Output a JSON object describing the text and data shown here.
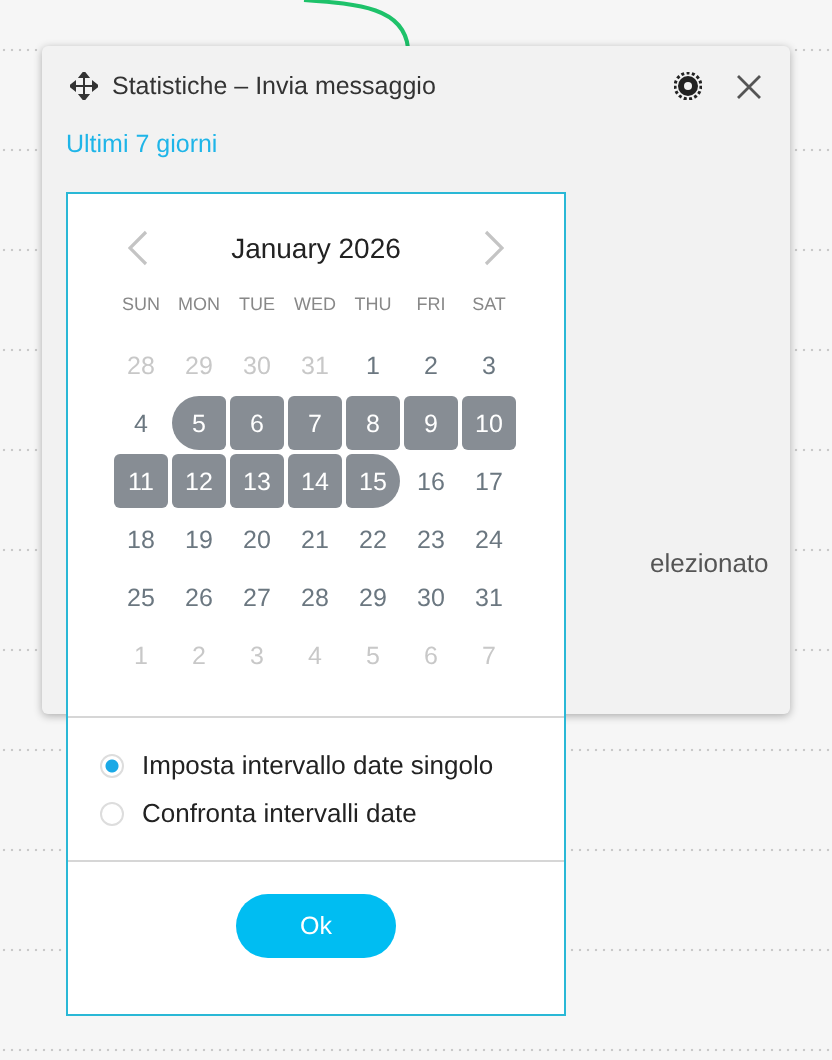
{
  "panel": {
    "title": "Statistiche – Invia messaggio",
    "range_link": "Ultimi 7 giorni",
    "background_text": "elezionato"
  },
  "calendar": {
    "month": "January 2026",
    "weekdays": [
      "SUN",
      "MON",
      "TUE",
      "WED",
      "THU",
      "FRI",
      "SAT"
    ],
    "weeks": [
      [
        {
          "label": "28",
          "outside": true,
          "selected": false
        },
        {
          "label": "29",
          "outside": true,
          "selected": false
        },
        {
          "label": "30",
          "outside": true,
          "selected": false
        },
        {
          "label": "31",
          "outside": true,
          "selected": false
        },
        {
          "label": "1",
          "outside": false,
          "selected": false
        },
        {
          "label": "2",
          "outside": false,
          "selected": false
        },
        {
          "label": "3",
          "outside": false,
          "selected": false
        }
      ],
      [
        {
          "label": "4",
          "outside": false,
          "selected": false
        },
        {
          "label": "5",
          "outside": false,
          "selected": true
        },
        {
          "label": "6",
          "outside": false,
          "selected": true
        },
        {
          "label": "7",
          "outside": false,
          "selected": true
        },
        {
          "label": "8",
          "outside": false,
          "selected": true
        },
        {
          "label": "9",
          "outside": false,
          "selected": true
        },
        {
          "label": "10",
          "outside": false,
          "selected": true
        }
      ],
      [
        {
          "label": "11",
          "outside": false,
          "selected": true
        },
        {
          "label": "12",
          "outside": false,
          "selected": true
        },
        {
          "label": "13",
          "outside": false,
          "selected": true
        },
        {
          "label": "14",
          "outside": false,
          "selected": true
        },
        {
          "label": "15",
          "outside": false,
          "selected": true
        },
        {
          "label": "16",
          "outside": false,
          "selected": false
        },
        {
          "label": "17",
          "outside": false,
          "selected": false
        }
      ],
      [
        {
          "label": "18",
          "outside": false,
          "selected": false
        },
        {
          "label": "19",
          "outside": false,
          "selected": false
        },
        {
          "label": "20",
          "outside": false,
          "selected": false
        },
        {
          "label": "21",
          "outside": false,
          "selected": false
        },
        {
          "label": "22",
          "outside": false,
          "selected": false
        },
        {
          "label": "23",
          "outside": false,
          "selected": false
        },
        {
          "label": "24",
          "outside": false,
          "selected": false
        }
      ],
      [
        {
          "label": "25",
          "outside": false,
          "selected": false
        },
        {
          "label": "26",
          "outside": false,
          "selected": false
        },
        {
          "label": "27",
          "outside": false,
          "selected": false
        },
        {
          "label": "28",
          "outside": false,
          "selected": false
        },
        {
          "label": "29",
          "outside": false,
          "selected": false
        },
        {
          "label": "30",
          "outside": false,
          "selected": false
        },
        {
          "label": "31",
          "outside": false,
          "selected": false
        }
      ],
      [
        {
          "label": "1",
          "outside": true,
          "selected": false
        },
        {
          "label": "2",
          "outside": true,
          "selected": false
        },
        {
          "label": "3",
          "outside": true,
          "selected": false
        },
        {
          "label": "4",
          "outside": true,
          "selected": false
        },
        {
          "label": "5",
          "outside": true,
          "selected": false
        },
        {
          "label": "6",
          "outside": true,
          "selected": false
        },
        {
          "label": "7",
          "outside": true,
          "selected": false
        }
      ]
    ]
  },
  "options": [
    {
      "label": "Imposta intervallo date singolo",
      "selected": true
    },
    {
      "label": "Confronta intervalli date",
      "selected": false
    }
  ],
  "ok_button": "Ok"
}
